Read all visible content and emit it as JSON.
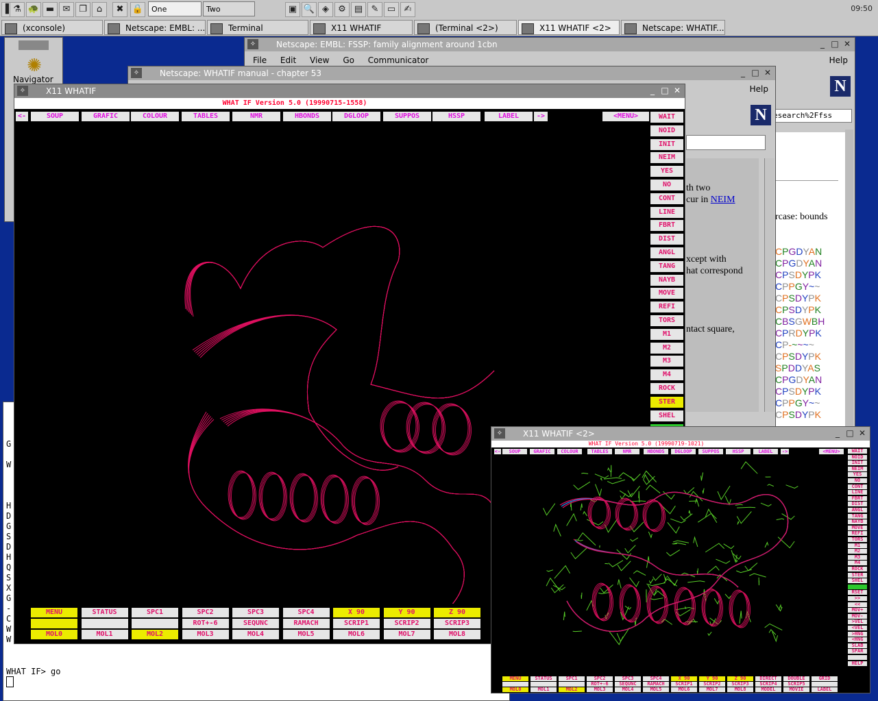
{
  "panel": {
    "desktops": [
      "One",
      "Two"
    ],
    "clock": "09:50"
  },
  "taskbar": [
    {
      "label": "(xconsole)"
    },
    {
      "label": "Netscape: EMBL: ..."
    },
    {
      "label": "Terminal"
    },
    {
      "label": "X11 WHATIF"
    },
    {
      "label": "(Terminal <2>)"
    },
    {
      "label": "X11 WHATIF <2>"
    },
    {
      "label": "Netscape: WHATIF..."
    }
  ],
  "navigator": {
    "label": "Navigator"
  },
  "netscape_fssp": {
    "title": "Netscape: EMBL: FSSP: family alignment around 1cbn",
    "menu": [
      "File",
      "Edit",
      "View",
      "Go",
      "Communicator"
    ],
    "help": "Help",
    "location_fragment": "esearch%2Ffss",
    "text_fragment": "rcase: bounds",
    "sequences": [
      {
        "text": "CPGDYAN"
      },
      {
        "text": "CPGDYAN"
      },
      {
        "text": "CPSDYPK"
      },
      {
        "text": "CPPGY~~"
      },
      {
        "text": "CPSDYPK"
      },
      {
        "text": "CPSDYPK"
      },
      {
        "text": "CBSGWBH"
      },
      {
        "text": "CPRDYPK"
      },
      {
        "text": "CP-~~~~"
      },
      {
        "text": "CPSDYPK"
      },
      {
        "text": "SPDDYAS"
      },
      {
        "text": "CPGDYAN"
      },
      {
        "text": "CPSDYPK"
      },
      {
        "text": "CPPGY~~"
      },
      {
        "text": "CPSDYPK"
      }
    ]
  },
  "netscape_manual": {
    "title": "Netscape: WHATIF manual - chapter 53",
    "help": "Help",
    "lines": [
      "th two",
      "cur in",
      "xcept with",
      "hat correspond",
      "ntact square,"
    ],
    "link": "NEIM"
  },
  "whatif_main": {
    "title": "X11 WHATIF",
    "version": "WHAT IF Version 5.0 (19990715-1558)",
    "top_menu": [
      "<-",
      "SOUP",
      "GRAFIC",
      "COLOUR",
      "TABLES",
      "NMR",
      "HBONDS",
      "DGLOOP",
      "SUPPOS",
      "HSSP",
      "LABEL",
      "->",
      "<MENU>"
    ],
    "side_buttons": [
      "WAIT",
      "NOID",
      "INIT",
      "NEIM",
      "YES",
      "NO",
      "CONT",
      "LINE",
      "FBRT",
      "DIST",
      "ANGL",
      "TANG",
      "NAYB",
      "MOVE",
      "REFI",
      "TORS",
      "M1",
      "M2",
      "M3",
      "M4",
      "ROCK",
      "STER",
      "SHEL"
    ],
    "bottom_rows": [
      [
        "MENU",
        "STATUS",
        "SPC1",
        "SPC2",
        "SPC3",
        "SPC4",
        "X 90",
        "Y 90",
        "Z 90"
      ],
      [
        "",
        "",
        "",
        "ROT+-6",
        "SEQUNC",
        "RAMACH",
        "SCRIP1",
        "SCRIP2",
        "SCRIP3"
      ],
      [
        "MOL0",
        "MOL1",
        "MOL2",
        "MOL3",
        "MOL4",
        "MOL5",
        "MOL6",
        "MOL7",
        "MOL8"
      ]
    ]
  },
  "whatif_second": {
    "title": "X11 WHATIF <2>",
    "version": "WHAT IF Version 5.0 (19990719-1021)",
    "top_menu": [
      "<-",
      "SOUP",
      "GRAFIC",
      "COLOUR",
      "TABLES",
      "NMR",
      "HBONDS",
      "DGLOOP",
      "SUPPOS",
      "HSSP",
      "LABEL",
      "->",
      "<MENU>"
    ],
    "side_buttons": [
      "WAIT",
      "NOID",
      "INIT",
      "NEIM",
      "YES",
      "NO",
      "CONT",
      "LINE",
      "FBRT",
      "DIST",
      "ANGL",
      "TANG",
      "NAYB",
      "MOVE",
      "REFI",
      "TORS",
      "M1",
      "M2",
      "M3",
      "M4",
      "ROCK",
      "STER",
      "SHEL",
      "",
      "RSET",
      ">>",
      "<<",
      "MOV+",
      "MOV-",
      ">VEL",
      "<VEL",
      ">HNG",
      "<HNG",
      "SLAB",
      "SPAR",
      "",
      "HELP"
    ],
    "bottom_rows": [
      [
        "MENU",
        "STATUS",
        "SPC1",
        "SPC2",
        "SPC3",
        "SPC4",
        "X 90",
        "Y 90",
        "Z 90",
        "DIRECT",
        "DOUBLE",
        "GRID"
      ],
      [
        "",
        "",
        "",
        "ROT+-6",
        "SEQUNC",
        "RAMACH",
        "SCRIP1",
        "SCRIP2",
        "SCRIP3",
        "SCRIP4",
        "SCRIP5",
        ""
      ],
      [
        "MOL0",
        "MOL1",
        "MOL2",
        "MOL3",
        "MOL4",
        "MOL5",
        "MOL6",
        "MOL7",
        "MOL8",
        "MODEL",
        "MOVIE",
        "LABEL"
      ]
    ]
  },
  "console": {
    "prompt": "WHAT IF> go",
    "left_letters": [
      "G",
      "W",
      "H",
      "D",
      "G",
      "S",
      "D",
      "H",
      "Q",
      "S",
      "X",
      "G",
      "-",
      "C",
      "W",
      "W"
    ]
  },
  "colors": {
    "molecule": "#e01060",
    "side_chain": "#58d028",
    "backbone_blue": "#2a8ae0",
    "button_text": "#e0106a",
    "title_text": "#ff0030",
    "menu_text": "#e010e0"
  }
}
